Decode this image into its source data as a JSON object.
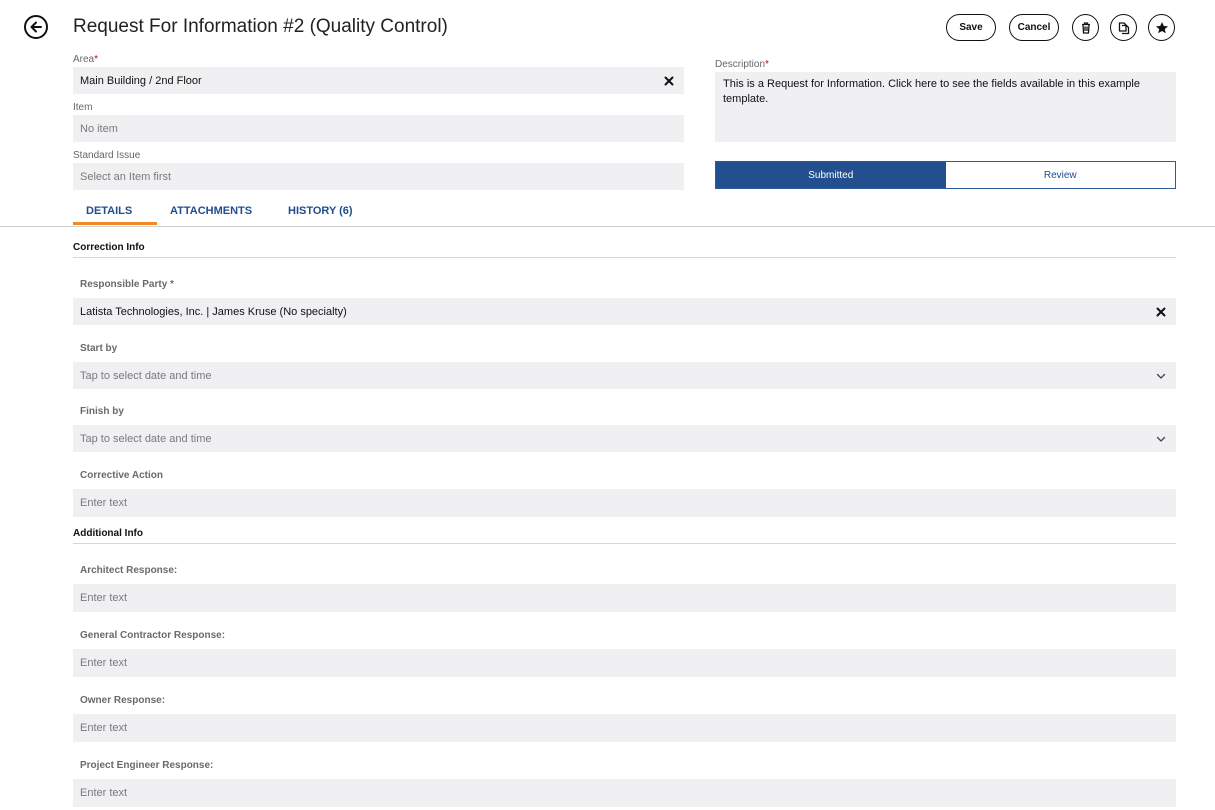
{
  "header": {
    "title": "Request For Information #2 (Quality Control)",
    "save_label": "Save",
    "cancel_label": "Cancel"
  },
  "form": {
    "area": {
      "label": "Area",
      "required_mark": "*",
      "value": "Main Building / 2nd Floor"
    },
    "item": {
      "label": "Item",
      "placeholder": "No item"
    },
    "standard_issue": {
      "label": "Standard Issue",
      "placeholder": "Select an Item first"
    },
    "description": {
      "label": "Description",
      "required_mark": "*",
      "value": "This is a Request for Information. Click here to see the fields available in this example template."
    }
  },
  "status": {
    "steps": [
      {
        "label": "Submitted",
        "active": true
      },
      {
        "label": "Review",
        "active": false
      }
    ],
    "active_color": "#234f8e"
  },
  "tabs": [
    {
      "label": "DETAILS",
      "selected": true
    },
    {
      "label": "ATTACHMENTS",
      "selected": false
    },
    {
      "label": "HISTORY (6)",
      "selected": false
    }
  ],
  "correction_info": {
    "heading": "Correction Info",
    "responsible_party": {
      "label": "Responsible Party *",
      "value": "Latista Technologies, Inc. | James Kruse (No specialty)"
    },
    "start_by": {
      "label": "Start by",
      "placeholder": "Tap to select date and time"
    },
    "finish_by": {
      "label": "Finish by",
      "placeholder": "Tap to select date and time"
    },
    "corrective_action": {
      "label": "Corrective Action",
      "placeholder": "Enter text"
    }
  },
  "additional_info": {
    "heading": "Additional Info",
    "architect": {
      "label": "Architect Response:",
      "placeholder": "Enter text"
    },
    "general_contractor": {
      "label": "General Contractor Response:",
      "placeholder": "Enter text"
    },
    "owner": {
      "label": "Owner Response:",
      "placeholder": "Enter text"
    },
    "project_engineer": {
      "label": "Project Engineer Response:",
      "placeholder": "Enter text"
    }
  },
  "icons": {
    "back": "arrow-left-icon",
    "delete": "trash-icon",
    "copy": "copy-icon",
    "favorite": "star-icon",
    "clear": "close-icon",
    "dropdown": "chevron-down-icon"
  },
  "colors": {
    "accent_tab": "#f08a24",
    "link": "#1f4e8c",
    "field_bg": "#f0f0f3",
    "required": "#cc0000"
  }
}
